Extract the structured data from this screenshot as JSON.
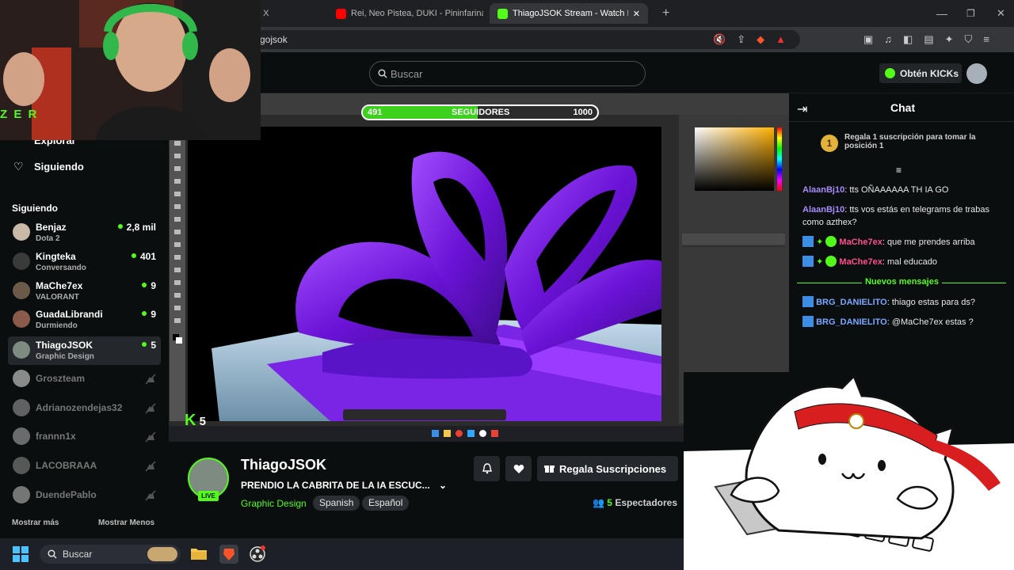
{
  "browser": {
    "tabs": [
      {
        "label": "/ X"
      },
      {
        "label": "Rei, Neo Pistea, DUKI - Pininfarina (Re"
      },
      {
        "label": "ThiagoJSOK Stream - Watch I"
      }
    ],
    "url": "gojsok"
  },
  "header": {
    "search_placeholder": "Buscar",
    "get_kicks": "Obtén KICKs"
  },
  "sidebar": {
    "explore": "Explorar",
    "following_link": "Siguiendo",
    "section_title": "Siguiendo",
    "channels": [
      {
        "name": "Benjaz",
        "category": "Dota 2",
        "viewers": "2,8 mil",
        "online": true
      },
      {
        "name": "Kingteka",
        "category": "Conversando",
        "viewers": "401",
        "online": true
      },
      {
        "name": "MaChe7ex",
        "category": "VALORANT",
        "viewers": "9",
        "online": true
      },
      {
        "name": "GuadaLibrandi",
        "category": "Durmiendo",
        "viewers": "9",
        "online": true
      },
      {
        "name": "ThiagoJSOK",
        "category": "Graphic Design",
        "viewers": "5",
        "online": true,
        "selected": true
      },
      {
        "name": "Groszteam",
        "online": false
      },
      {
        "name": "Adrianozendejas32",
        "online": false
      },
      {
        "name": "frannn1x",
        "online": false
      },
      {
        "name": "LACOBRAAA",
        "online": false
      },
      {
        "name": "DuendePablo",
        "online": false
      }
    ],
    "show_more": "Mostrar más",
    "show_less": "Mostrar Menos"
  },
  "overlay": {
    "webcam_text": "Z E R",
    "sub_goal_current": "491",
    "sub_goal_label": "SEGUIDORES",
    "sub_goal_target": "1000",
    "sub_goal_progress": 0.49,
    "kick_count": "5"
  },
  "stream": {
    "streamer": "ThiagoJSOK",
    "live_badge": "LIVE",
    "title": "PRENDIO LA CABRITA DE LA IA ESCUC...",
    "category": "Graphic Design",
    "tags": [
      "Spanish",
      "Español"
    ],
    "gift_button": "Regala Suscripciones",
    "viewers_count": "5",
    "viewers_label": "Espectadores"
  },
  "chat": {
    "title": "Chat",
    "pinned_rank": "1",
    "pinned": "Regala 1 suscripción para tomar la posición 1",
    "messages_top": [
      {
        "user": "AlaanBj10",
        "color": "#a78bfa",
        "text": "tts OÑAAAAAA TH IA GO"
      },
      {
        "user": "AlaanBj10",
        "color": "#a78bfa",
        "text": "tts vos estás en telegrams de trabas como azthex?"
      },
      {
        "user": "MaChe7ex",
        "color": "#ff4f8b",
        "text": "que me prendes arriba"
      },
      {
        "user": "MaChe7ex",
        "color": "#ff4f8b",
        "text": "mal educado"
      }
    ],
    "new_messages": "Nuevos mensajes",
    "messages_bottom": [
      {
        "user": "BRG_DANIELITO",
        "color": "#7aa7ff",
        "text": "thiago estas para ds?"
      },
      {
        "user": "BRG_DANIELITO",
        "color": "#7aa7ff",
        "text": "@MaChe7ex estas ?"
      }
    ]
  },
  "taskbar": {
    "search": "Buscar"
  },
  "colors": {
    "kick_green": "#53fc18",
    "bg": "#0b0e0f"
  }
}
